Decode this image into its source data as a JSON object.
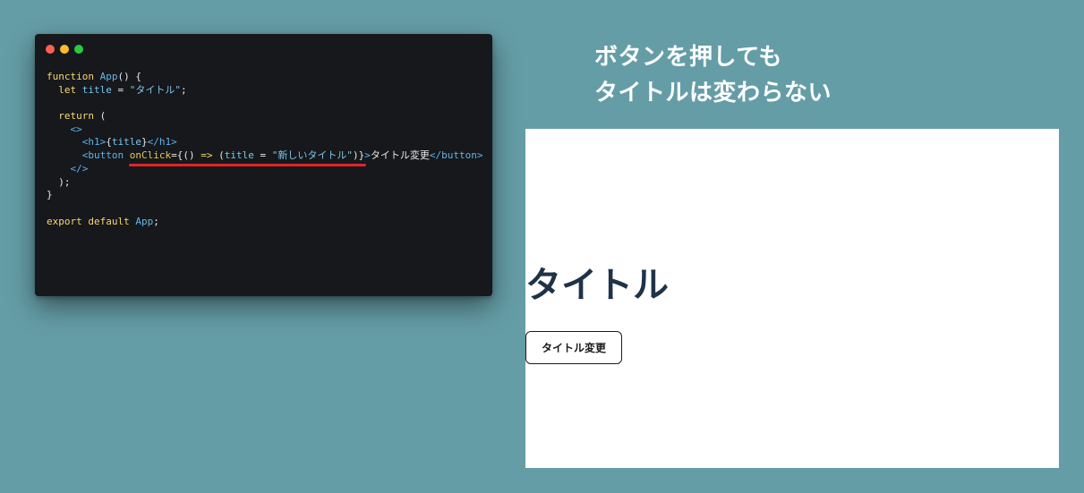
{
  "caption": {
    "line1": "ボタンを押しても",
    "line2": "タイトルは変わらない"
  },
  "code_window": {
    "lines": [
      [
        {
          "t": "function ",
          "c": "kw"
        },
        {
          "t": "App",
          "c": "fn"
        },
        {
          "t": "() {",
          "c": "plain"
        }
      ],
      [
        {
          "t": "  let ",
          "c": "kw"
        },
        {
          "t": "title",
          "c": "var"
        },
        {
          "t": " = ",
          "c": "plain"
        },
        {
          "t": "\"タイトル\"",
          "c": "str"
        },
        {
          "t": ";",
          "c": "plain"
        }
      ],
      [
        {
          "t": "",
          "c": "plain"
        }
      ],
      [
        {
          "t": "  return ",
          "c": "kw"
        },
        {
          "t": "(",
          "c": "plain"
        }
      ],
      [
        {
          "t": "    ",
          "c": "plain"
        },
        {
          "t": "<>",
          "c": "tag"
        }
      ],
      [
        {
          "t": "      ",
          "c": "plain"
        },
        {
          "t": "<h1>",
          "c": "tag"
        },
        {
          "t": "{",
          "c": "plain"
        },
        {
          "t": "title",
          "c": "var"
        },
        {
          "t": "}",
          "c": "plain"
        },
        {
          "t": "</h1>",
          "c": "tag"
        }
      ],
      [
        {
          "t": "      ",
          "c": "plain"
        },
        {
          "t": "<button ",
          "c": "tag"
        },
        {
          "t": "onClick",
          "c": "attr"
        },
        {
          "t": "={() ",
          "c": "plain"
        },
        {
          "t": "=>",
          "c": "kw"
        },
        {
          "t": " (",
          "c": "plain"
        },
        {
          "t": "title",
          "c": "var"
        },
        {
          "t": " = ",
          "c": "plain"
        },
        {
          "t": "\"新しいタイトル\"",
          "c": "str"
        },
        {
          "t": ")}",
          "c": "plain"
        },
        {
          "t": ">",
          "c": "tag"
        },
        {
          "t": "タイトル変更",
          "c": "plain"
        },
        {
          "t": "</button>",
          "c": "tag"
        }
      ],
      [
        {
          "t": "    ",
          "c": "plain"
        },
        {
          "t": "</>",
          "c": "tag"
        }
      ],
      [
        {
          "t": "  );",
          "c": "plain"
        }
      ],
      [
        {
          "t": "}",
          "c": "plain"
        }
      ],
      [
        {
          "t": "",
          "c": "plain"
        }
      ],
      [
        {
          "t": "export default ",
          "c": "kw"
        },
        {
          "t": "App",
          "c": "fn"
        },
        {
          "t": ";",
          "c": "plain"
        }
      ]
    ]
  },
  "preview": {
    "heading": "タイトル",
    "button_label": "タイトル変更"
  },
  "colors": {
    "background": "#659da6",
    "code_background": "#16181b",
    "underline": "#e02424",
    "heading": "#1f3347"
  }
}
